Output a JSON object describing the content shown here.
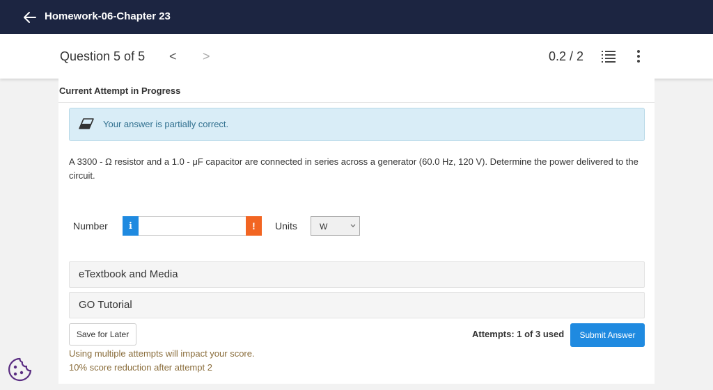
{
  "topbar": {
    "title": "Homework-06-Chapter 23"
  },
  "question_nav": {
    "title": "Question 5 of 5",
    "prev_glyph": "<",
    "next_glyph": ">",
    "score": "0.2 / 2"
  },
  "attempt_heading": "Current Attempt in Progress",
  "alert": {
    "text": "Your answer is partially correct."
  },
  "question_text": "A 3300 - Ω resistor and a 1.0 - μF capacitor are connected in series across a generator (60.0 Hz, 120 V). Determine the power delivered to the circuit.",
  "answer": {
    "number_label": "Number",
    "info_glyph": "i",
    "number_value": "",
    "warning_glyph": "!",
    "units_label": "Units",
    "units_value": "W"
  },
  "panels": {
    "etextbook": "eTextbook and Media",
    "go_tutorial": "GO Tutorial"
  },
  "footer": {
    "save_label": "Save for Later",
    "attempts": "Attempts: 1 of 3 used",
    "submit_label": "Submit Answer",
    "warning_line_1": "Using multiple attempts will impact your score.",
    "warning_line_2": "10% score reduction after attempt 2"
  },
  "colors": {
    "topbar": "#1c2541",
    "accent": "#1f8ae0",
    "warning": "#f26522",
    "alert_bg": "#d9edf7",
    "alert_text": "#31708f",
    "penalty_text": "#8a6d3b"
  }
}
